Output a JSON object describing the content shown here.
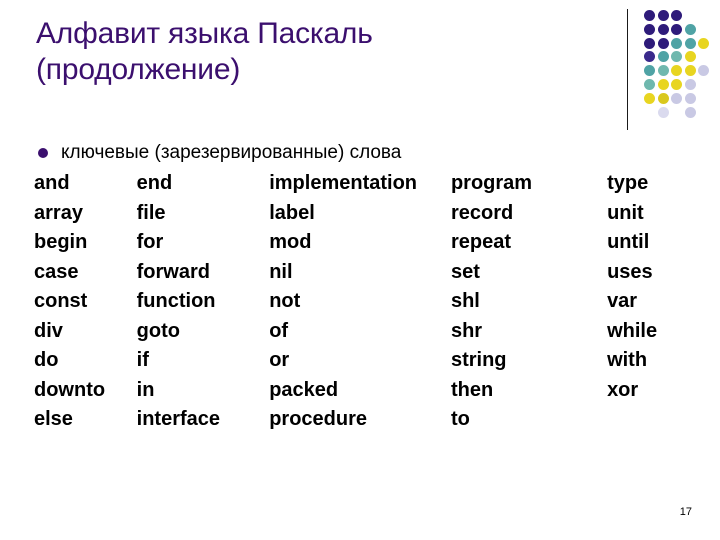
{
  "slide": {
    "title": "Алфавит языка Паскаль\n(продолжение)",
    "title_color": "#3B0F6E",
    "page_number": "17",
    "background_color": "#FFFFFF"
  },
  "bullet": {
    "marker_icon": "bullet-dot-icon",
    "marker_color": "#3B0F6E",
    "text": "ключевые (зарезервированные) слова"
  },
  "keywords": {
    "columns": [
      [
        "and",
        "array",
        "begin",
        "case",
        "const",
        "div",
        "do",
        "downto",
        "else"
      ],
      [
        "end",
        "file",
        "for",
        "forward",
        "function",
        "goto",
        "if",
        "in",
        "interface"
      ],
      [
        "implementation",
        "label",
        "mod",
        "nil",
        "not",
        "of",
        "or",
        "packed",
        "procedure"
      ],
      [
        "program",
        "record",
        "repeat",
        "set",
        "shl",
        "shr",
        "string",
        "then",
        "to"
      ],
      [
        "type",
        "unit",
        "until",
        "uses",
        "var",
        "while",
        "with",
        "xor",
        ""
      ]
    ],
    "rows": [
      [
        "and",
        "end",
        "implementation",
        "program",
        "type"
      ],
      [
        "array",
        "file",
        "label",
        "record",
        "unit"
      ],
      [
        "begin",
        "for",
        "mod",
        "repeat",
        "until"
      ],
      [
        "case",
        "forward",
        "nil",
        "set",
        "uses"
      ],
      [
        "const",
        "function",
        "not",
        "shl",
        "var"
      ],
      [
        "div",
        "goto",
        "of",
        "shr",
        "while"
      ],
      [
        "do",
        "if",
        "or",
        "string",
        "with"
      ],
      [
        "downto",
        "in",
        "packed",
        "then",
        "xor"
      ],
      [
        "else",
        "interface",
        "procedure",
        "to",
        ""
      ]
    ],
    "text_color": "#000000"
  },
  "decoration": {
    "name": "dot-grid-decoration",
    "divider_color": "#1A1A1A",
    "palette": {
      "dark_purple": "#2E1B7A",
      "indigo": "#3A2A8C",
      "teal": "#4FA3A5",
      "sea_green": "#6FB8AE",
      "yellow": "#E8D520",
      "gold": "#D9C81E",
      "lavender": "#C9C9E4",
      "pale": "#DADAEE"
    },
    "grid": [
      [
        "dark_purple",
        "dark_purple",
        "dark_purple",
        "",
        ""
      ],
      [
        "dark_purple",
        "dark_purple",
        "dark_purple",
        "teal",
        ""
      ],
      [
        "dark_purple",
        "dark_purple",
        "teal",
        "teal",
        "yellow"
      ],
      [
        "indigo",
        "teal",
        "sea_green",
        "yellow",
        ""
      ],
      [
        "teal",
        "sea_green",
        "yellow",
        "yellow",
        "lavender"
      ],
      [
        "sea_green",
        "yellow",
        "yellow",
        "lavender",
        ""
      ],
      [
        "yellow",
        "gold",
        "lavender",
        "lavender",
        ""
      ],
      [
        "",
        "pale",
        "",
        "lavender",
        ""
      ]
    ]
  }
}
